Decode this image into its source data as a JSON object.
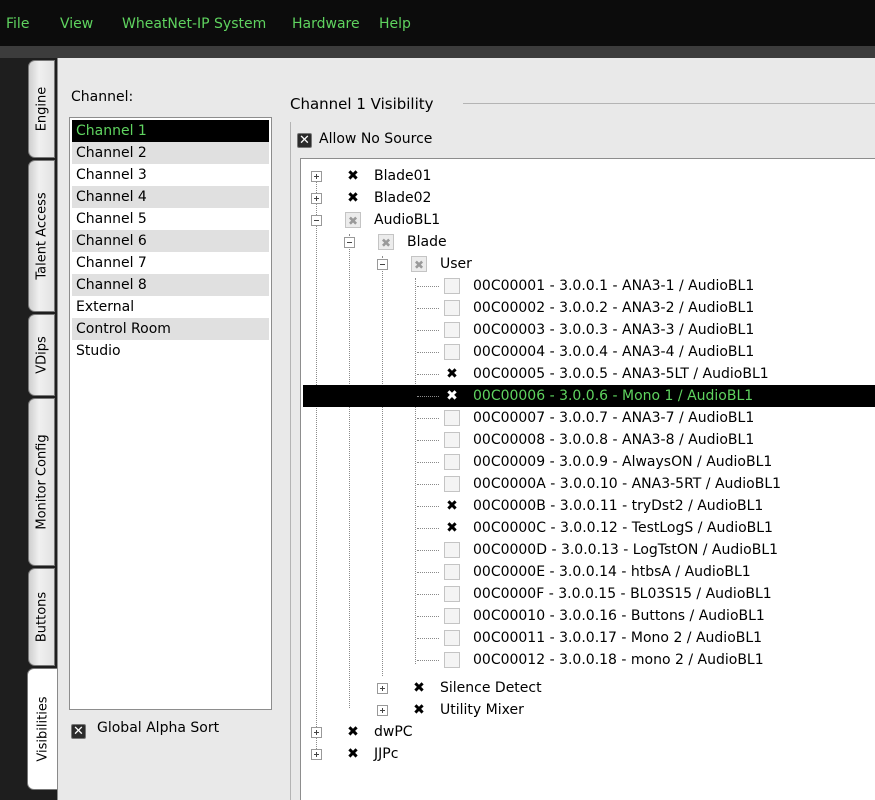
{
  "menu": [
    "File",
    "View",
    "WheatNet-IP System",
    "Hardware",
    "Help"
  ],
  "tabs": [
    "Engine",
    "Talent Access",
    "VDips",
    "Monitor Config",
    "Buttons",
    "Visibilities"
  ],
  "channel_label": "Channel:",
  "channels": [
    "Channel 1",
    "Channel 2",
    "Channel 3",
    "Channel 4",
    "Channel 5",
    "Channel 6",
    "Channel 7",
    "Channel 8",
    "External",
    "Control Room",
    "Studio"
  ],
  "global_alpha_sort": "Global Alpha Sort",
  "visibility_title": "Channel 1 Visibility",
  "allow_no_source": "Allow No Source",
  "tree": {
    "blade01": "Blade01",
    "blade02": "Blade02",
    "audiobl1": "AudioBL1",
    "blade": "Blade",
    "user": "User",
    "sources": [
      "00C00001 - 3.0.0.1 - ANA3-1 / AudioBL1",
      "00C00002 - 3.0.0.2 - ANA3-2 / AudioBL1",
      "00C00003 - 3.0.0.3 - ANA3-3 / AudioBL1",
      "00C00004 - 3.0.0.4 - ANA3-4 / AudioBL1",
      "00C00005 - 3.0.0.5 - ANA3-5LT / AudioBL1",
      "00C00006 - 3.0.0.6 - Mono 1 / AudioBL1",
      "00C00007 - 3.0.0.7 - ANA3-7 / AudioBL1",
      "00C00008 - 3.0.0.8 - ANA3-8 / AudioBL1",
      "00C00009 - 3.0.0.9 - AlwaysON / AudioBL1",
      "00C0000A - 3.0.0.10 - ANA3-5RT / AudioBL1",
      "00C0000B - 3.0.0.11 - tryDst2 / AudioBL1",
      "00C0000C - 3.0.0.12 - TestLogS / AudioBL1",
      "00C0000D - 3.0.0.13 - LogTstON / AudioBL1",
      "00C0000E - 3.0.0.14 - htbsA / AudioBL1",
      "00C0000F - 3.0.0.15 - BL03S15 / AudioBL1",
      "00C00010 - 3.0.0.16 - Buttons / AudioBL1",
      "00C00011 - 3.0.0.17 - Mono 2 / AudioBL1",
      "00C00012 - 3.0.0.18 - mono 2 / AudioBL1"
    ],
    "silence_detect": "Silence Detect",
    "utility_mixer": "Utility Mixer",
    "dwpc": "dwPC",
    "jjpc": "JJPc"
  },
  "colors": {
    "accent_green": "#5fd35f",
    "selection_bg": "#000000"
  }
}
